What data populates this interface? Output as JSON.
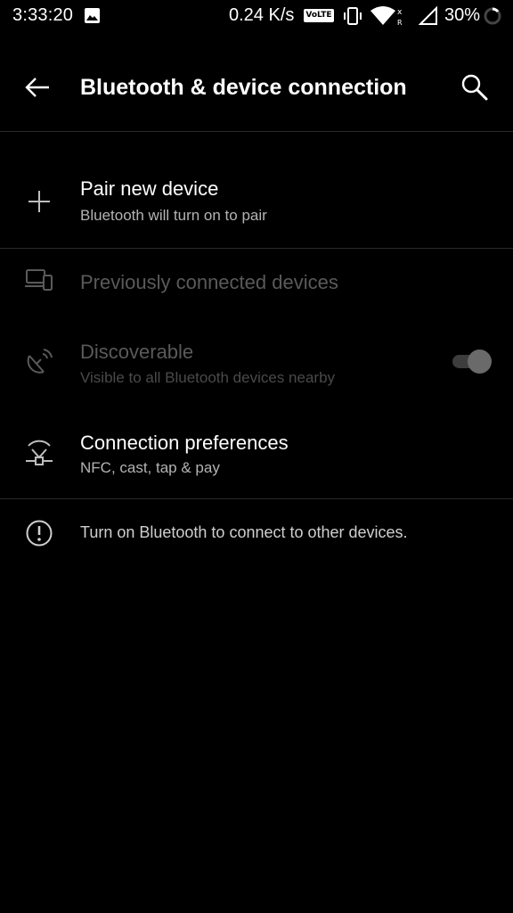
{
  "status_bar": {
    "time": "3:33:20",
    "net_speed": "0.24 K/s",
    "volte": "VoLTE",
    "battery": "30%"
  },
  "app_bar": {
    "title": "Bluetooth & device connection",
    "back_icon": "arrow-left-icon",
    "search_icon": "search-icon"
  },
  "items": [
    {
      "title": "Pair new device",
      "subtitle": "Bluetooth will turn on to pair",
      "icon": "plus-icon",
      "enabled": true
    },
    {
      "title": "Previously connected devices",
      "icon": "devices-icon",
      "enabled": false
    },
    {
      "title": "Discoverable",
      "subtitle": "Visible to all Bluetooth devices nearby",
      "icon": "satellite-dish-icon",
      "enabled": false,
      "toggle_on": true
    },
    {
      "title": "Connection preferences",
      "subtitle": "NFC, cast, tap & pay",
      "icon": "connected-devices-icon",
      "enabled": true
    }
  ],
  "info": {
    "text": "Turn on Bluetooth to connect to other devices.",
    "icon": "info-circle-icon"
  },
  "colors": {
    "background": "#000000",
    "primary_text": "#ffffff",
    "disabled_text": "#5a5a5a"
  }
}
